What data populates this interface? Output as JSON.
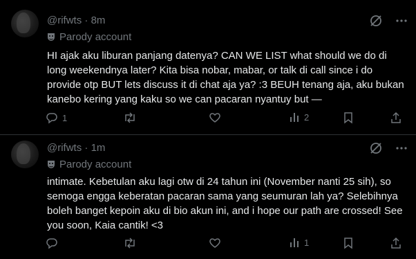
{
  "posts": [
    {
      "handle": "@rifwts",
      "sep": "·",
      "time": "8m",
      "badge": "Parody account",
      "text": "HI ajak aku liburan panjang datenya? CAN WE LIST what should we do di long weekendnya later? Kita bisa nobar, mabar, or talk di call since i do provide otp BUT lets discuss it di chat aja ya? :3 BEUH tenang aja, aku bukan kanebo kering yang kaku so we can pacaran nyantuy but —",
      "replies": "1",
      "reposts": "",
      "likes": "",
      "views": "2"
    },
    {
      "handle": "@rifwts",
      "sep": "·",
      "time": "1m",
      "badge": "Parody account",
      "text": "intimate. Kebetulan aku lagi otw di 24 tahun ini (November nanti 25 sih), so semoga engga keberatan pacaran sama yang seumuran lah ya? Selebihnya boleh banget kepoin aku di bio akun ini, and i hope our path are crossed! See you soon, Kaia cantik! <3",
      "replies": "",
      "reposts": "",
      "likes": "",
      "views": "1"
    }
  ],
  "colors": {
    "text": "#e7e9ea",
    "muted": "#71767b",
    "divider": "#2f3336",
    "background": "#000000"
  }
}
